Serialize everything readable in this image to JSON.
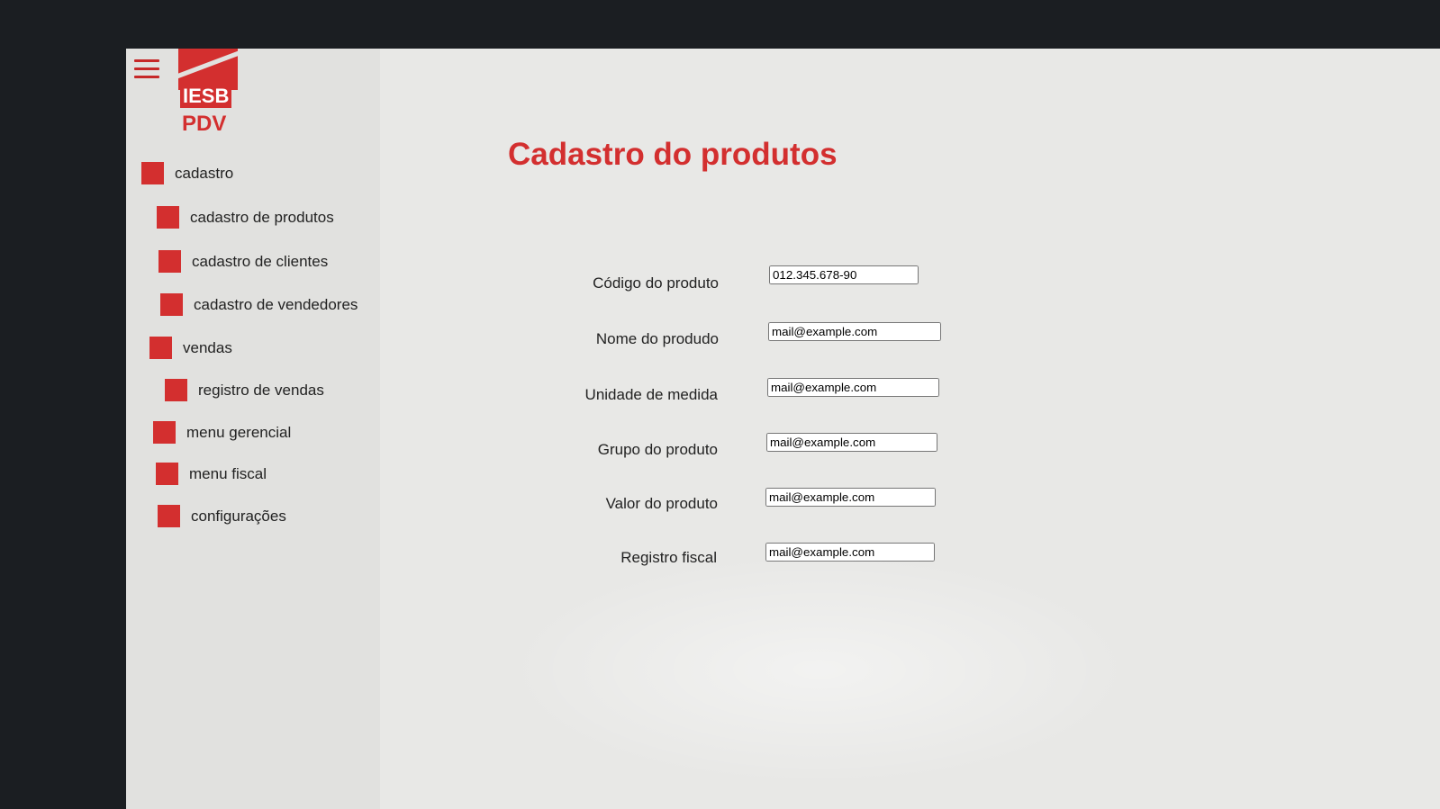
{
  "app": {
    "logo_top": "IESB",
    "logo_bottom": "PDV",
    "accent_color": "#d32f2f"
  },
  "sidebar": {
    "menu_icon": "hamburger-menu-icon",
    "items": [
      {
        "label": "cadastro"
      },
      {
        "label": "cadastro de produtos"
      },
      {
        "label": "cadastro de clientes"
      },
      {
        "label": "cadastro de vendedores"
      },
      {
        "label": "vendas"
      },
      {
        "label": "registro de vendas"
      },
      {
        "label": "menu gerencial"
      },
      {
        "label": "menu fiscal"
      },
      {
        "label": "configurações"
      }
    ]
  },
  "main": {
    "title": "Cadastro do produtos",
    "fields": [
      {
        "label": "Código do produto",
        "value": "012.345.678-90"
      },
      {
        "label": "Nome do produdo",
        "value": "mail@example.com"
      },
      {
        "label": "Unidade de medida",
        "value": "mail@example.com"
      },
      {
        "label": "Grupo do produto",
        "value": "mail@example.com"
      },
      {
        "label": "Valor do produto",
        "value": "mail@example.com"
      },
      {
        "label": "Registro fiscal",
        "value": "mail@example.com"
      }
    ]
  }
}
